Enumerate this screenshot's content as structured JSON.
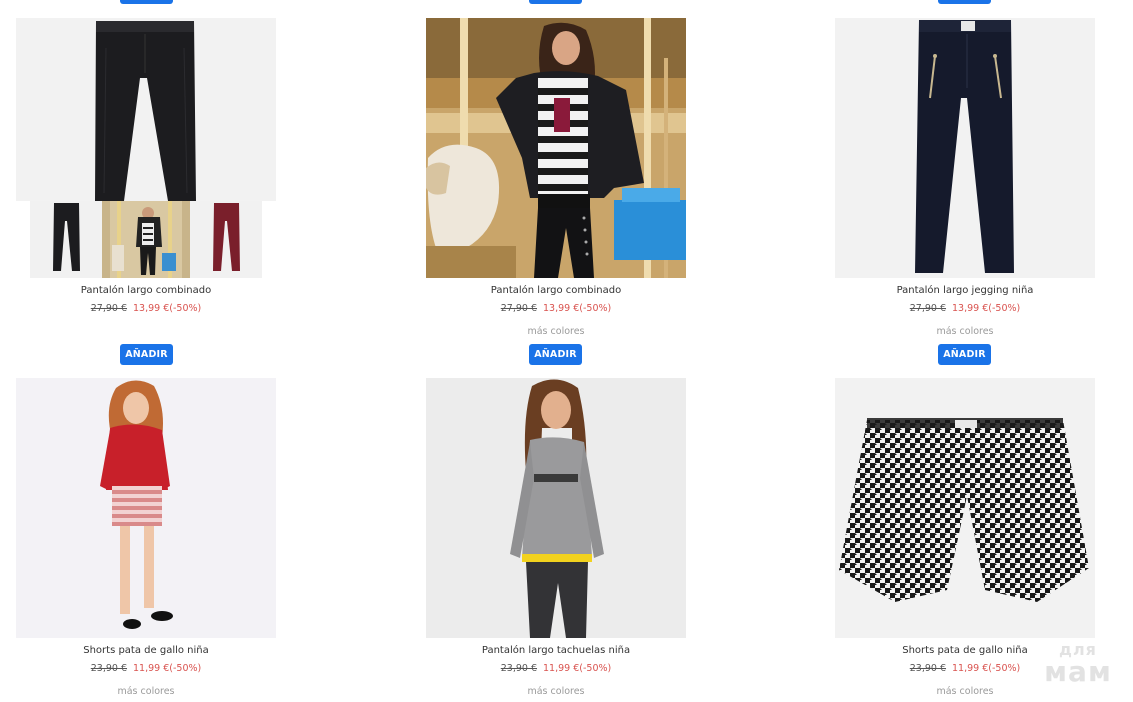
{
  "add_label": "AÑADIR",
  "more_colors_label": "más colores",
  "products": [
    {
      "name": "Pantalón largo combinado",
      "old_price": "27,90 €",
      "new_price": "13,99 €(-50%)",
      "more_colors": ""
    },
    {
      "name": "Pantalón largo combinado",
      "old_price": "27,90 €",
      "new_price": "13,99 €(-50%)",
      "more_colors": "más colores"
    },
    {
      "name": "Pantalón largo jegging niña",
      "old_price": "27,90 €",
      "new_price": "13,99 €(-50%)",
      "more_colors": "más colores"
    },
    {
      "name": "Shorts pata de gallo niña",
      "old_price": "23,90 €",
      "new_price": "11,99 €(-50%)",
      "more_colors": "más colores"
    },
    {
      "name": "Pantalón largo tachuelas niña",
      "old_price": "23,90 €",
      "new_price": "11,99 €(-50%)",
      "more_colors": "más colores"
    },
    {
      "name": "Shorts pata de gallo niña",
      "old_price": "23,90 €",
      "new_price": "11,99 €(-50%)",
      "more_colors": "más colores"
    }
  ],
  "watermark": {
    "line1": "для",
    "line2": "мам"
  },
  "colors": {
    "accent": "#1a73e8",
    "sale": "#d9534f"
  }
}
